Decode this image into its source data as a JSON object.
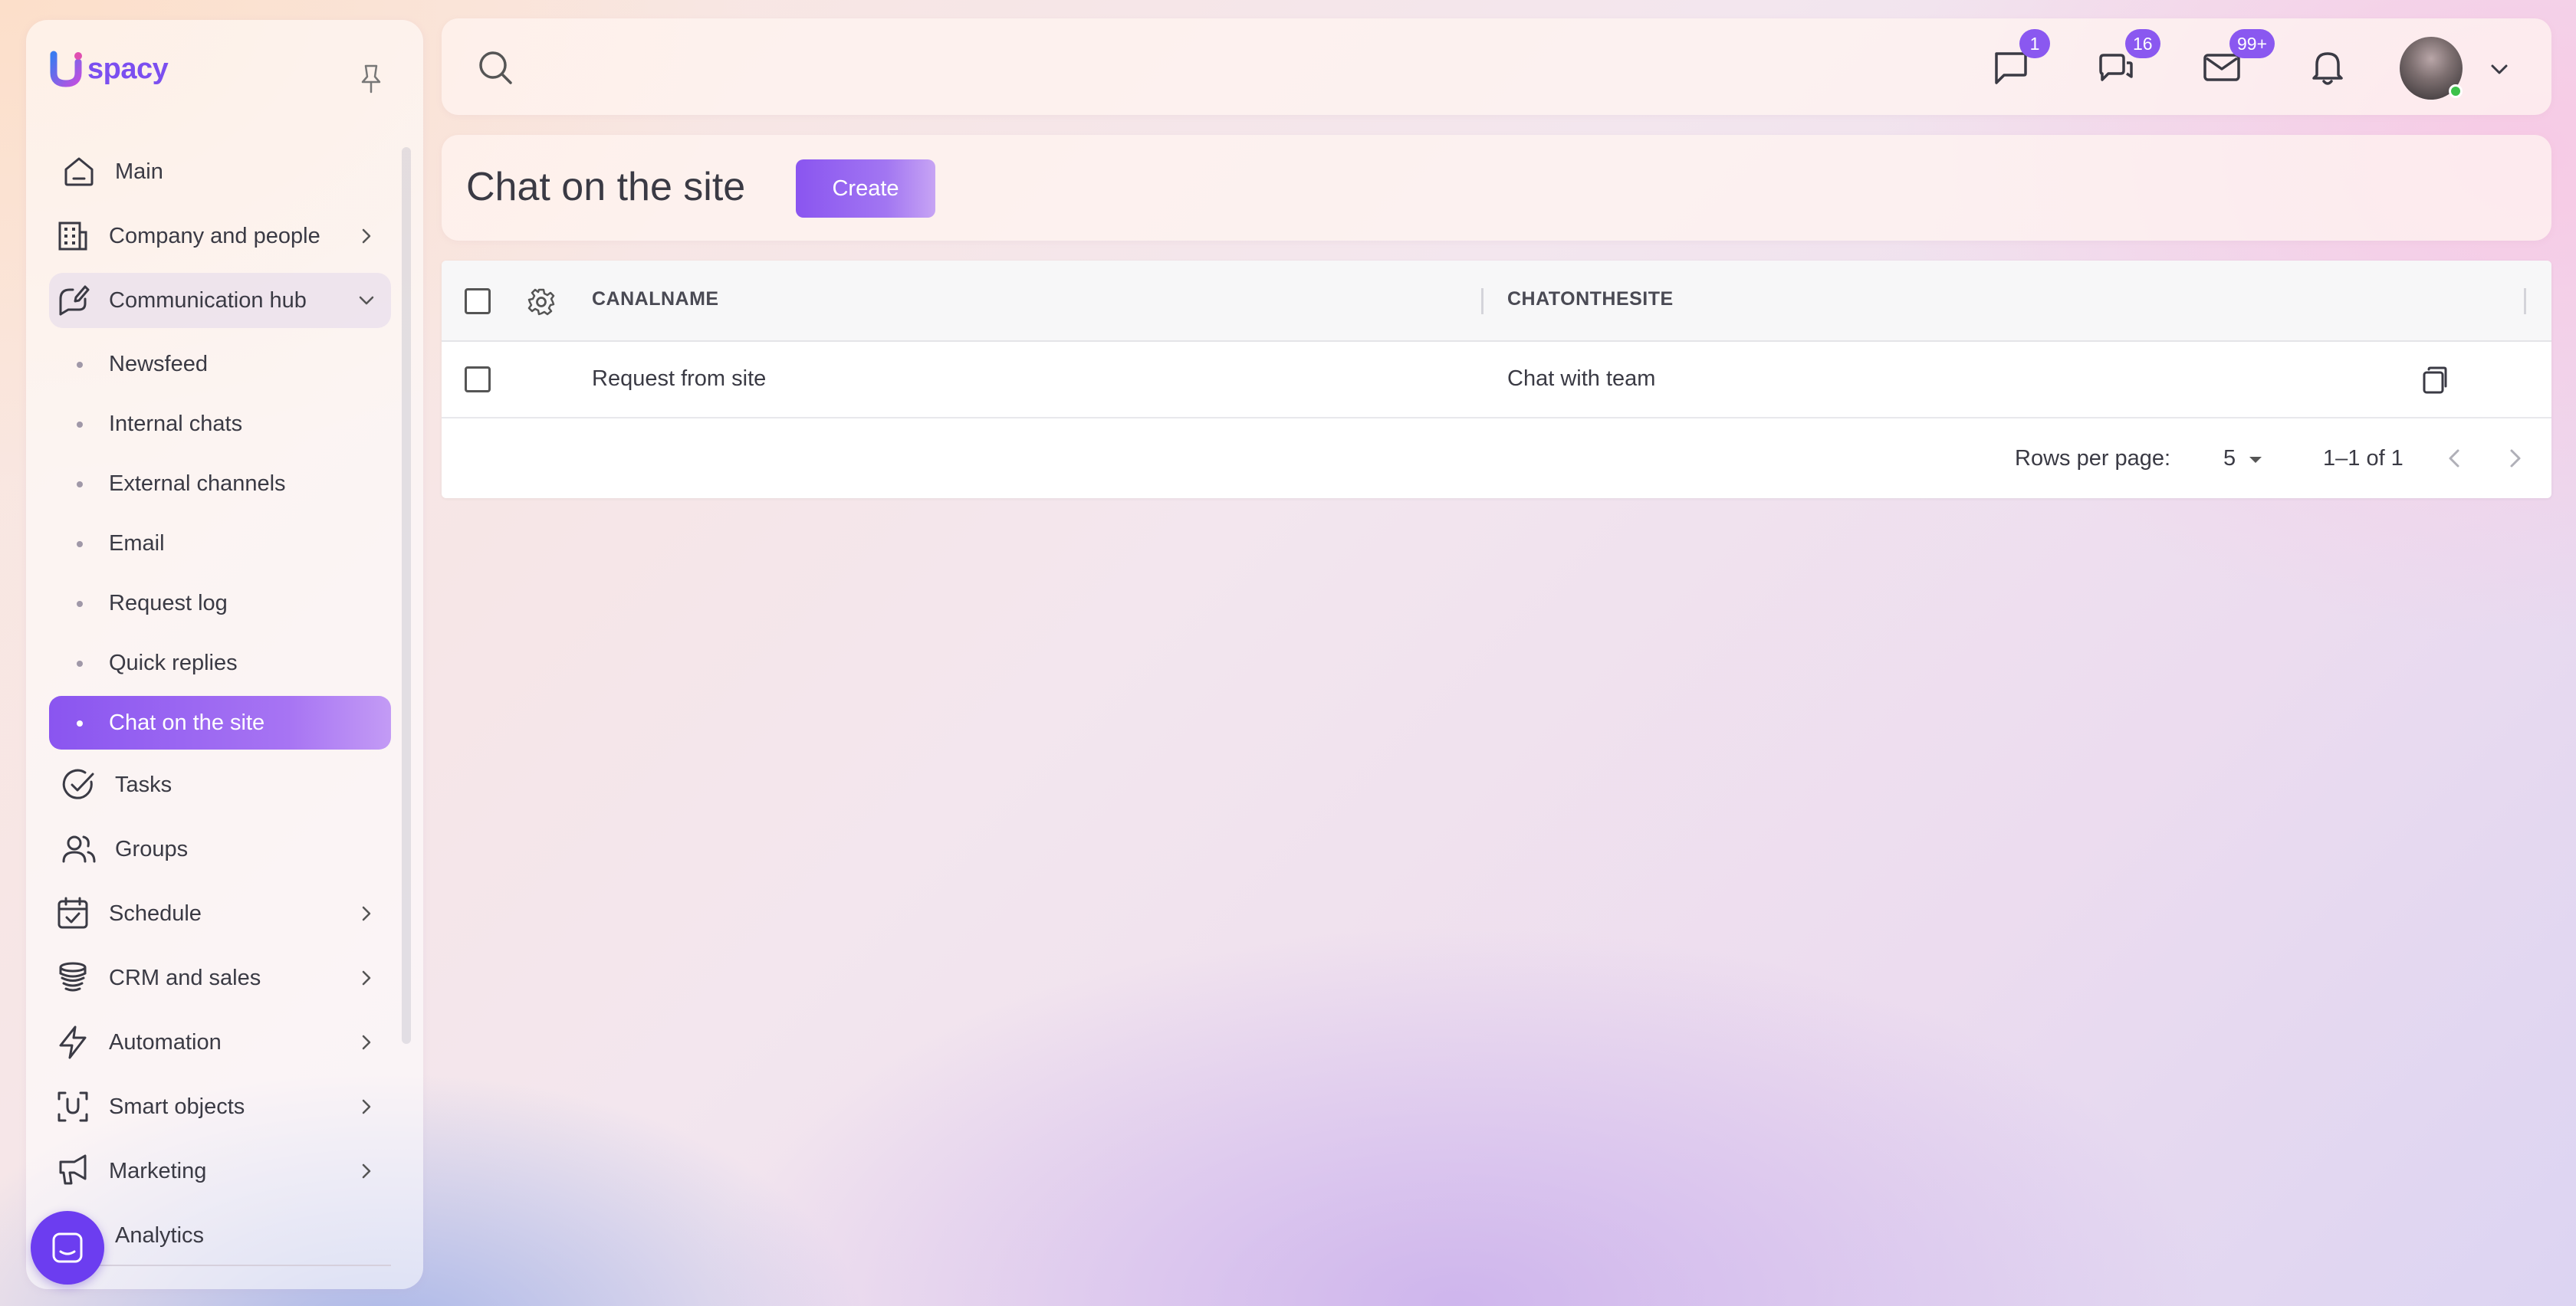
{
  "app": {
    "logo_text": "spacy"
  },
  "colors": {
    "accent": "#8a55f0",
    "badge": "#8a58f0",
    "fab": "#6c3df0",
    "online": "#3cc24a"
  },
  "sidebar": {
    "items": [
      {
        "label": "Main",
        "icon": "home-icon"
      },
      {
        "label": "Company and people",
        "icon": "building-icon"
      },
      {
        "label": "Communication hub",
        "icon": "chat-hub-icon"
      },
      {
        "label": "Tasks",
        "icon": "check-circle-icon"
      },
      {
        "label": "Groups",
        "icon": "users-icon"
      },
      {
        "label": "Schedule",
        "icon": "calendar-check-icon"
      },
      {
        "label": "CRM and sales",
        "icon": "database-stack-icon"
      },
      {
        "label": "Automation",
        "icon": "lightning-icon"
      },
      {
        "label": "Smart objects",
        "icon": "scan-icon"
      },
      {
        "label": "Marketing",
        "icon": "megaphone-icon"
      },
      {
        "label": "Analytics",
        "icon": "chart-icon"
      }
    ],
    "sub_items": [
      {
        "label": "Newsfeed"
      },
      {
        "label": "Internal chats"
      },
      {
        "label": "External channels"
      },
      {
        "label": "Email"
      },
      {
        "label": "Request log"
      },
      {
        "label": "Quick replies"
      },
      {
        "label": "Chat on the site"
      }
    ]
  },
  "topbar": {
    "badges": {
      "chat": "1",
      "messages": "16",
      "mail": "99+"
    }
  },
  "page": {
    "title": "Chat on the site",
    "create_label": "Create"
  },
  "table": {
    "columns": [
      "CANALNAME",
      "CHATONTHESITE"
    ],
    "rows": [
      {
        "canalname": "Request from site",
        "chatonthesite": "Chat with team"
      }
    ],
    "footer": {
      "rows_per_page_label": "Rows per page:",
      "rows_per_page_value": "5",
      "range": "1–1 of 1"
    }
  }
}
